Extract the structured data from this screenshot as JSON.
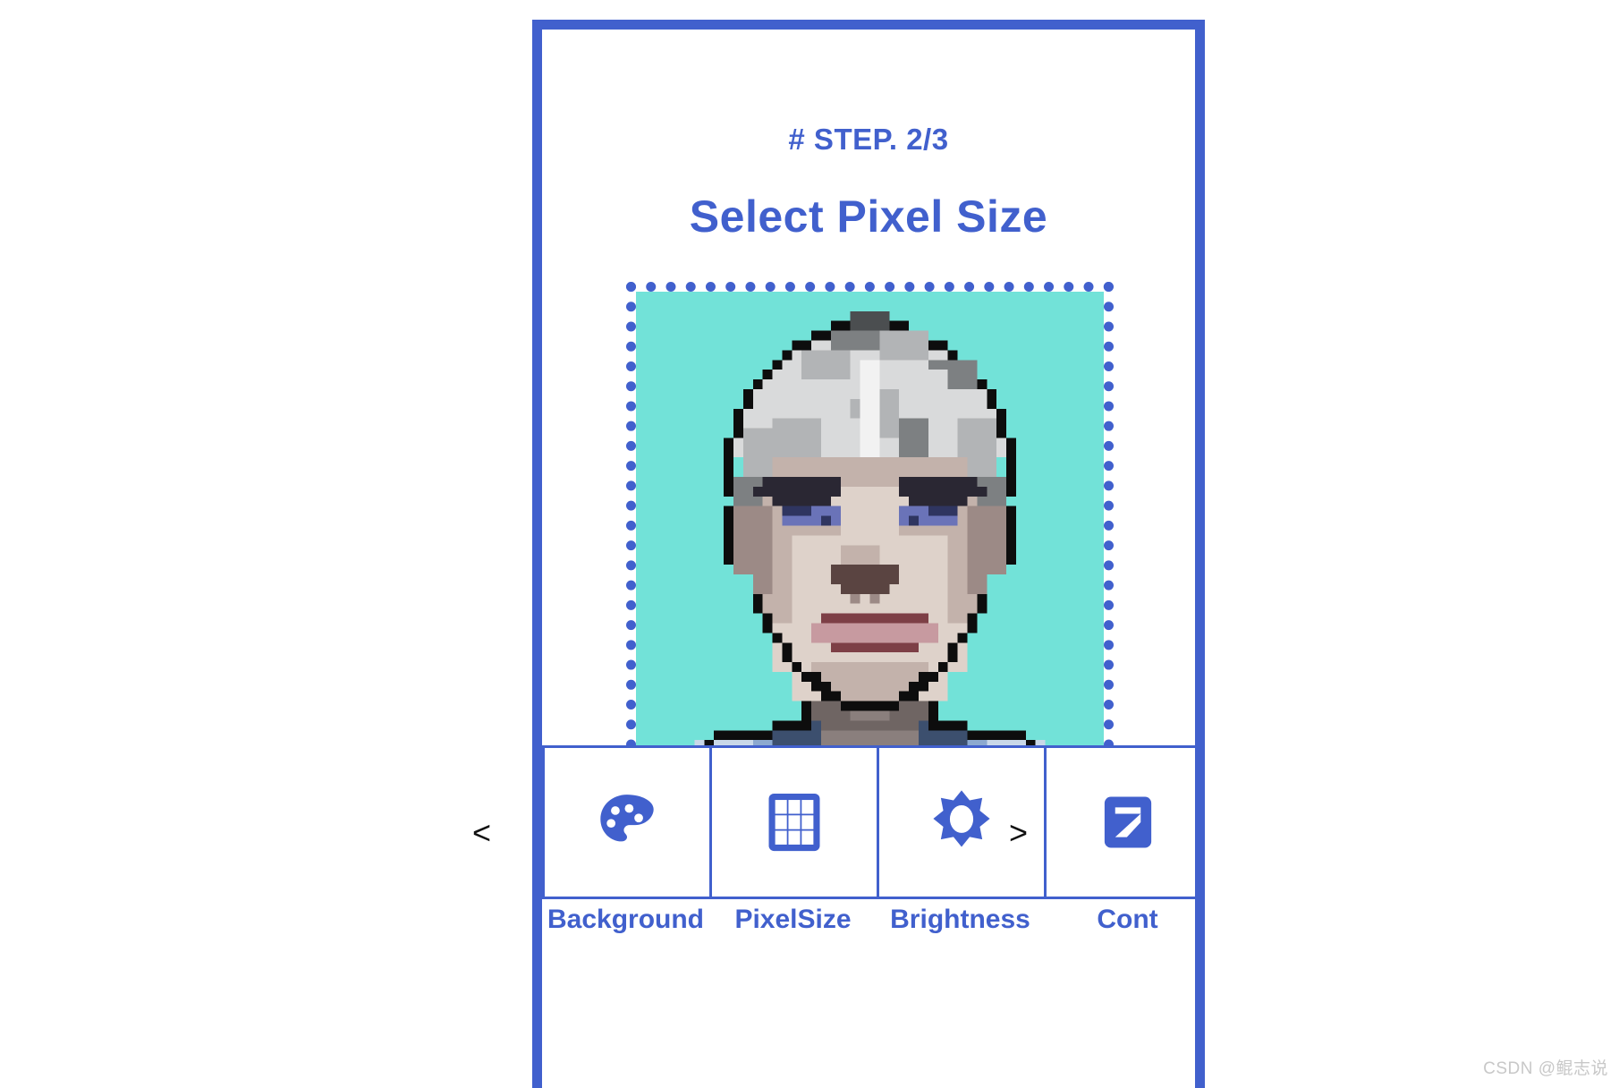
{
  "app": {
    "step_label": "# STEP. 2/3",
    "title": "Select Pixel Size",
    "frame_color": "#4160cd",
    "accent_color": "#4160cd",
    "background_color": "#ffffff"
  },
  "preview": {
    "name": "pixel-art-portrait-preview",
    "canvas_background": "#72e2d8",
    "selection_border_color": "#4160cd",
    "selection_border_style": "dotted",
    "description": "Pixel-art portrait of a person with white/grey spiked hair, dark eyebrows, blue eyes, on a turquoise background"
  },
  "toolbar": {
    "items": [
      {
        "label": "Background",
        "icon": "palette-icon",
        "selected": false
      },
      {
        "label": "PixelSize",
        "icon": "grid-icon",
        "selected": true
      },
      {
        "label": "Brightness",
        "icon": "brightness-icon",
        "selected": false
      },
      {
        "label": "Cont",
        "icon": "contrast-icon",
        "selected": false
      }
    ],
    "prev_arrow": "<",
    "next_arrow": ">"
  },
  "watermark": {
    "text": "CSDN @鲲志说"
  }
}
